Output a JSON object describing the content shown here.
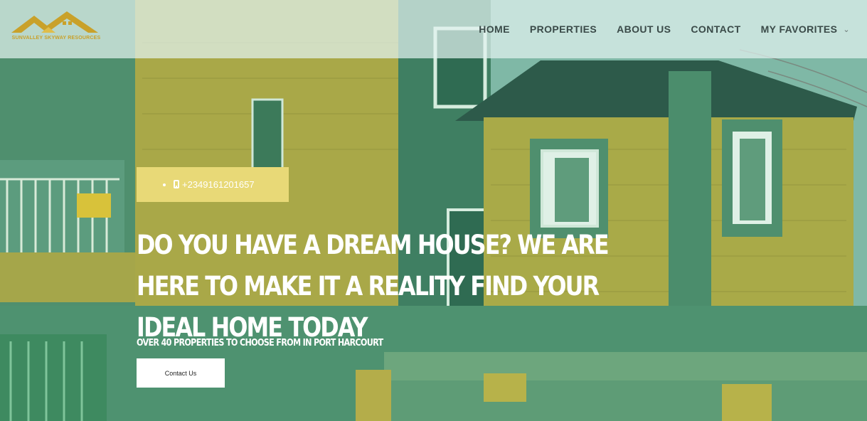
{
  "brand": {
    "name": "SUNVALLEY SKYWAY RESOURCES",
    "logo_color": "#c9a12a"
  },
  "nav": {
    "items": [
      {
        "label": "HOME"
      },
      {
        "label": "PROPERTIES"
      },
      {
        "label": "ABOUT US"
      },
      {
        "label": "CONTACT"
      },
      {
        "label": "MY FAVORITES",
        "icon": "chevron-down-icon"
      }
    ]
  },
  "hero": {
    "phone": "+2349161201657",
    "phone_icon": "mobile-phone-icon",
    "headline": "DO YOU HAVE A DREAM HOUSE? WE ARE HERE TO MAKE IT A REALITY FIND YOUR IDEAL HOME TODAY",
    "subheadline": "OVER 40 PROPERTIES TO CHOOSE FROM IN PORT HARCOURT",
    "cta_label": "Contact Us",
    "accent_color": "#e8d977"
  }
}
